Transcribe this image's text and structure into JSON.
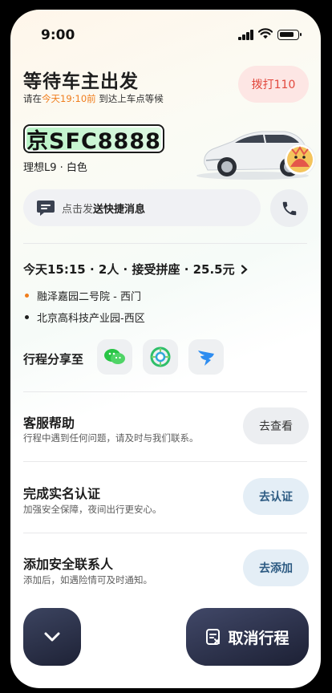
{
  "status_bar": {
    "time": "9:00"
  },
  "header": {
    "title": "等待车主出发",
    "subtitle_prefix": "请在",
    "subtitle_highlight": "今天19:10前",
    "subtitle_suffix": " 到达上车点等候",
    "highlight_color": "#f07d1c",
    "dial_button_label": "拨打110"
  },
  "vehicle": {
    "plate": "京SFC8888",
    "model_color": "理想L9 · 白色"
  },
  "message_bar": {
    "prefix": "点击发",
    "bold": "送快捷消息"
  },
  "trip": {
    "summary": "今天15:15 · 2人 · 接受拼座 · 25.5元",
    "start": "融泽嘉园二号院 - 西门",
    "end": "北京高科技产业园-西区",
    "start_dot_color": "#f07d1c",
    "end_dot_color": "#1f1f1f"
  },
  "share": {
    "label": "行程分享至",
    "targets": [
      "wechat-icon",
      "moments-icon",
      "dingtalk-icon"
    ]
  },
  "rows": [
    {
      "title": "客服帮助",
      "desc": "行程中遇到任何问题，请及时与我们联系。",
      "button": "去查看"
    },
    {
      "title": "完成实名认证",
      "desc": "加强安全保障，夜间出行更安心。",
      "button": "去认证"
    },
    {
      "title": "添加安全联系人",
      "desc": "添加后，如遇险情可及时通知。",
      "button": "去添加"
    }
  ],
  "bottom": {
    "cancel_label": "取消行程"
  }
}
